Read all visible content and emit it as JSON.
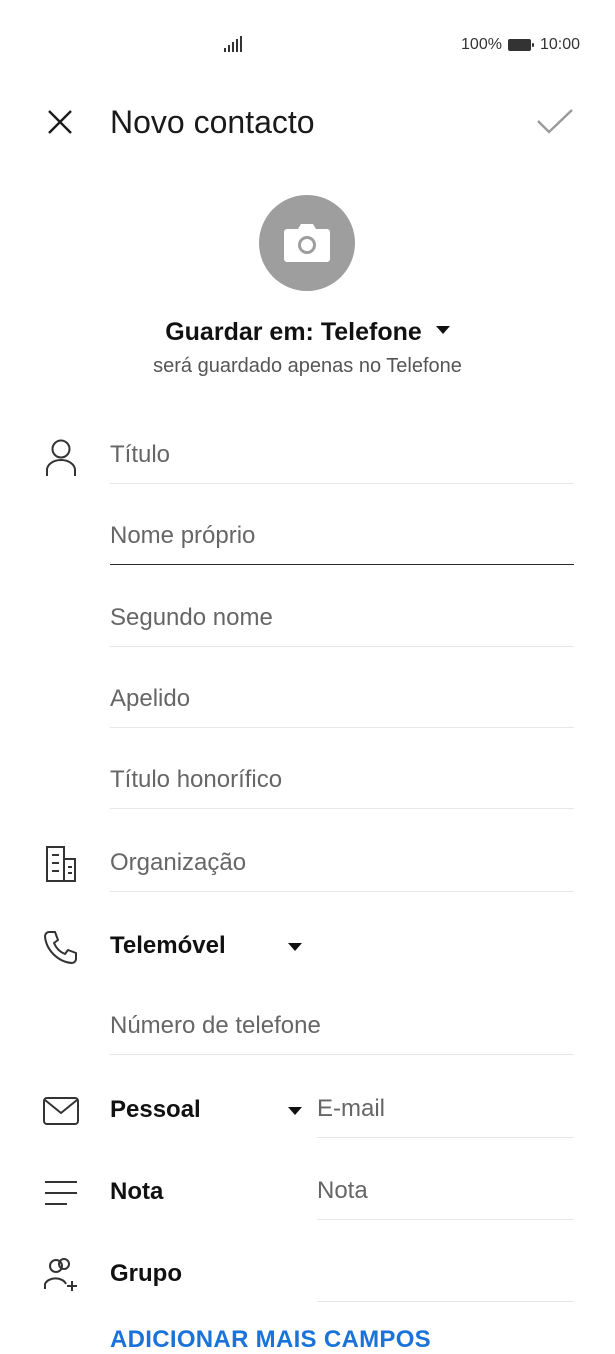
{
  "status_bar": {
    "battery_percent": "100%",
    "time": "10:00",
    "signal_icon": "signal-bars-icon",
    "battery_icon": "battery-full-icon"
  },
  "header": {
    "title": "Novo contacto",
    "close_icon": "close-icon",
    "confirm_icon": "check-icon"
  },
  "photo": {
    "icon": "camera-icon",
    "bg_color": "#9e9e9e"
  },
  "save_location": {
    "label": "Guardar em: Telefone",
    "subtitle": "será guardado apenas no Telefone"
  },
  "name_fields": {
    "icon": "person-icon",
    "title_placeholder": "Título",
    "first_name_placeholder": "Nome próprio",
    "middle_name_placeholder": "Segundo nome",
    "last_name_placeholder": "Apelido",
    "suffix_placeholder": "Título honorífico"
  },
  "organization": {
    "icon": "building-icon",
    "placeholder": "Organização"
  },
  "phone": {
    "icon": "phone-icon",
    "type_label": "Telemóvel",
    "placeholder": "Número de telefone"
  },
  "email": {
    "icon": "mail-icon",
    "type_label": "Pessoal",
    "placeholder": "E-mail"
  },
  "note": {
    "icon": "note-lines-icon",
    "label": "Nota",
    "placeholder": "Nota"
  },
  "group": {
    "icon": "group-add-icon",
    "label": "Grupo"
  },
  "add_more_label": "ADICIONAR MAIS CAMPOS",
  "colors": {
    "accent": "#1a73d9",
    "text": "#1a1a1a",
    "divider": "#e6e6e6"
  }
}
